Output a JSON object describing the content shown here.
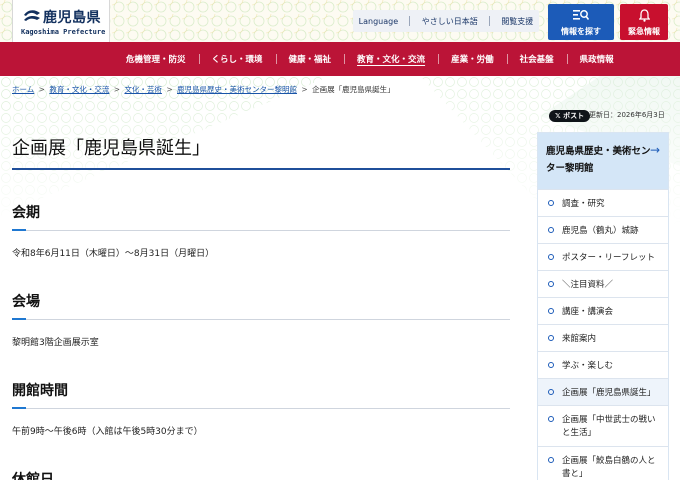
{
  "header": {
    "logo_title": "鹿児島県",
    "logo_sub": "Kagoshima Prefecture",
    "utility": [
      "Language",
      "やさしい日本語",
      "閲覧支援"
    ],
    "search_label": "情報を探す",
    "emergency_label": "緊急情報",
    "colors": {
      "navy": "#12305e",
      "search": "#1c5bb8",
      "emergency": "#c8102e"
    }
  },
  "nav": {
    "items": [
      "危機管理・防災",
      "くらし・環境",
      "健康・福祉",
      "教育・文化・交流",
      "産業・労働",
      "社会基盤",
      "県政情報"
    ],
    "color": "#bb1437"
  },
  "breadcrumb": {
    "items": [
      "ホーム",
      "教育・文化・交流",
      "文化・芸術",
      "鹿児島県歴史・美術センター黎明館"
    ],
    "current": "企画展「鹿児島県誕生」",
    "separator": ">"
  },
  "meta": {
    "post_label": "ポスト",
    "updated": "更新日：2026年6月3日"
  },
  "main": {
    "title": "企画展「鹿児島県誕生」",
    "sections": [
      {
        "heading": "会期",
        "body": "令和8年6月11日（木曜日）～8月31日（月曜日）"
      },
      {
        "heading": "会場",
        "body": "黎明館3階企画展示室"
      },
      {
        "heading": "開館時間",
        "body": "午前9時～午後6時（入館は午後5時30分まで）"
      },
      {
        "heading": "休館日",
        "body": ""
      }
    ]
  },
  "side": {
    "heading": "鹿児島県歴史・美術センター黎明館",
    "items": [
      "調査・研究",
      "鹿児島（鶴丸）城跡",
      "ポスター・リーフレット",
      "＼注目資料／",
      "講座・講演会",
      "来館案内",
      "学ぶ・楽しむ",
      "企画展「鹿児島県誕生」",
      "企画展「中世武士の戦いと生活」",
      "企画展「鮫島白鶴の人と書と」"
    ]
  }
}
